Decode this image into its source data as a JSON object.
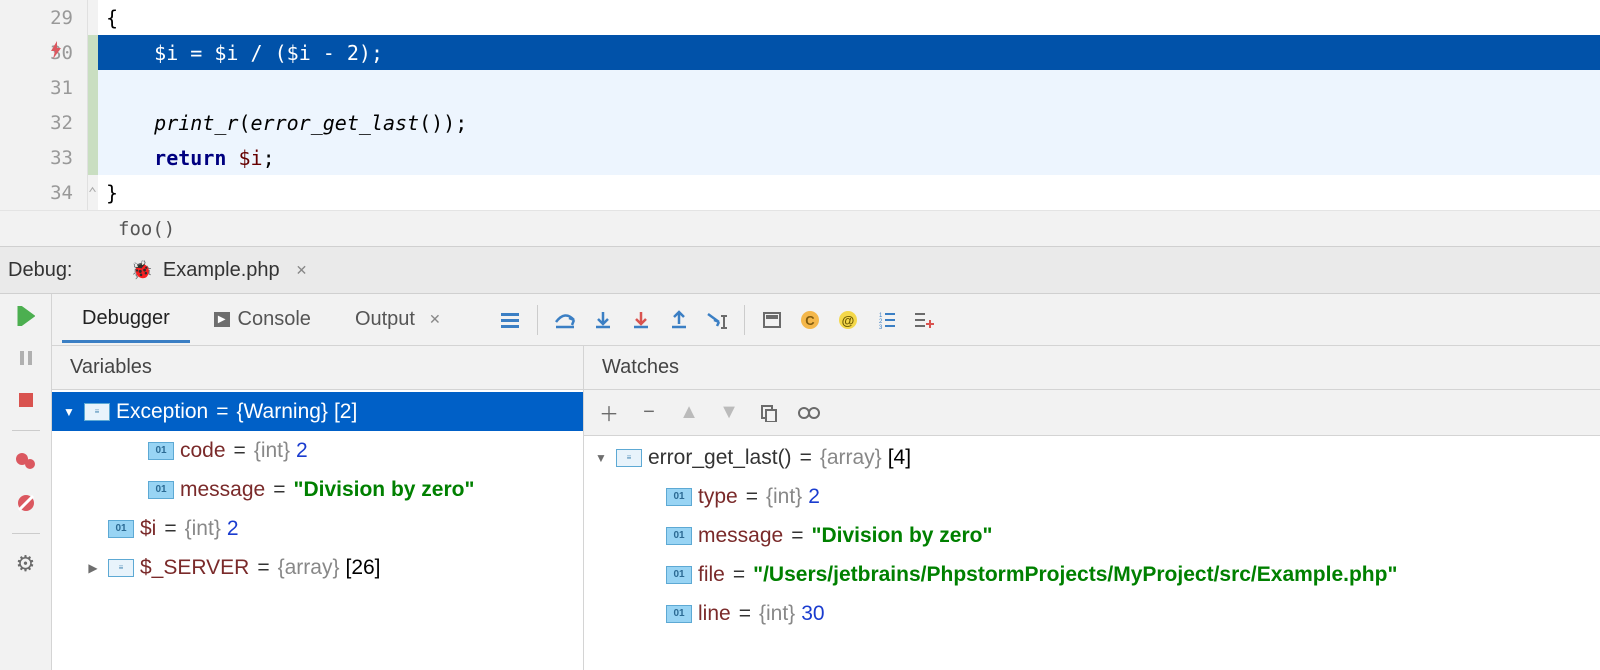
{
  "editor": {
    "lines": [
      {
        "num": "29",
        "text": "{",
        "cls": "white"
      },
      {
        "num": "30",
        "text": "$i = $i / ($i - 2);",
        "cls": "hl",
        "icon": "lightning"
      },
      {
        "num": "31",
        "text": ""
      },
      {
        "num": "32",
        "text": "print_r(error_get_last());"
      },
      {
        "num": "33",
        "text": "return $i;"
      },
      {
        "num": "34",
        "text": "}",
        "cls": "white",
        "fold": true
      }
    ],
    "indent": "    ",
    "tokens": {
      "l30": [
        [
          "    ",
          ""
        ],
        [
          "$i",
          "var"
        ],
        [
          " = ",
          "op"
        ],
        [
          "$i",
          "var"
        ],
        [
          " / (",
          "op"
        ],
        [
          "$i",
          "var"
        ],
        [
          " - ",
          "op"
        ],
        [
          "2",
          "op"
        ],
        [
          ");",
          "op"
        ]
      ],
      "l32": [
        [
          "    ",
          ""
        ],
        [
          "print_r",
          "fn"
        ],
        [
          "(",
          "op"
        ],
        [
          "error_get_last",
          "fn"
        ],
        [
          "());",
          "op"
        ]
      ],
      "l33": [
        [
          "    ",
          ""
        ],
        [
          "return ",
          "kw"
        ],
        [
          "$i",
          "var"
        ],
        [
          ";",
          "op"
        ]
      ]
    }
  },
  "breadcrumb": "foo()",
  "debugLabel": "Debug:",
  "debugTab": "Example.php",
  "toolbar": {
    "tabs": {
      "debugger": "Debugger",
      "console": "Console",
      "output": "Output"
    }
  },
  "panels": {
    "variables": "Variables",
    "watches": "Watches"
  },
  "vars": {
    "root": {
      "name": "Exception",
      "type": "{Warning}",
      "count": "[2]"
    },
    "children": [
      {
        "key": "code",
        "type": "{int}",
        "val": "2",
        "vtype": "int"
      },
      {
        "key": "message",
        "type": "",
        "val": "\"Division by zero\"",
        "vtype": "str"
      }
    ],
    "siblings": [
      {
        "key": "$i",
        "type": "{int}",
        "val": "2",
        "vtype": "int",
        "arrow": ""
      },
      {
        "key": "$_SERVER",
        "type": "{array}",
        "val": "[26]",
        "vtype": "plain",
        "arrow": "▶",
        "ico": "arr"
      }
    ]
  },
  "watches": {
    "root": {
      "name": "error_get_last()",
      "type": "{array}",
      "count": "[4]"
    },
    "children": [
      {
        "key": "type",
        "type": "{int}",
        "val": "2",
        "vtype": "int"
      },
      {
        "key": "message",
        "type": "",
        "val": "\"Division by zero\"",
        "vtype": "str"
      },
      {
        "key": "file",
        "type": "",
        "val": "\"/Users/jetbrains/PhpstormProjects/MyProject/src/Example.php\"",
        "vtype": "str"
      },
      {
        "key": "line",
        "type": "{int}",
        "val": "30",
        "vtype": "int"
      }
    ]
  }
}
